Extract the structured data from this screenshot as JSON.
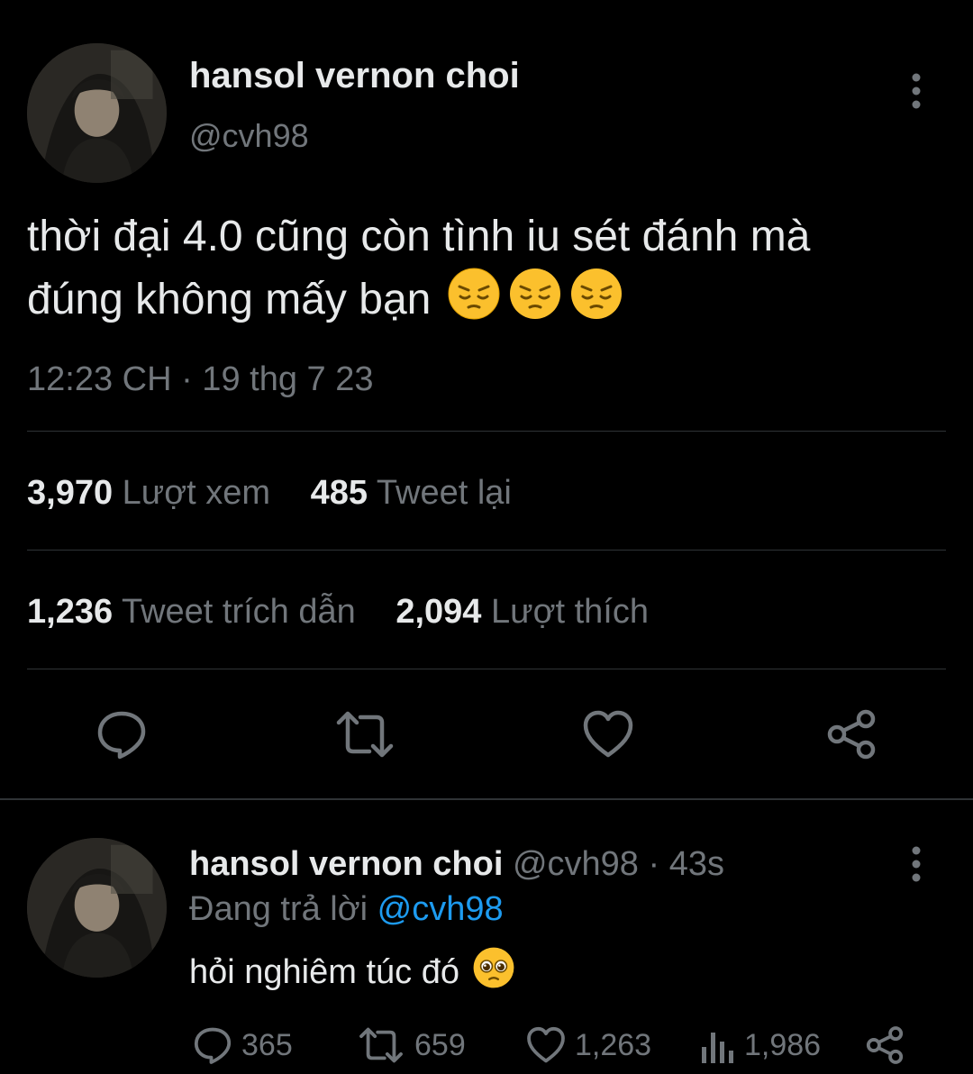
{
  "main_tweet": {
    "author_name": "hansol vernon choi",
    "handle": "@cvh98",
    "text_line1": "thời đại 4.0 cũng còn tình iu sét đánh mà",
    "text_line2": "đúng không mấy bạn",
    "emojis": [
      "pensive-face",
      "pensive-face",
      "pensive-face"
    ],
    "timestamp": "12:23 CH · 19 thg 7 23",
    "stats": {
      "views_count": "3,970",
      "views_label": "Lượt xem",
      "retweets_count": "485",
      "retweets_label": "Tweet lại",
      "quotes_count": "1,236",
      "quotes_label": "Tweet trích dẫn",
      "likes_count": "2,094",
      "likes_label": "Lượt thích"
    },
    "actions": [
      "reply-icon",
      "retweet-icon",
      "like-icon",
      "share-icon"
    ]
  },
  "reply_tweet": {
    "author_name": "hansol vernon choi",
    "handle_time": "@cvh98 · 43s",
    "replying_prefix": "Đang trả lời",
    "replying_to": "@cvh98",
    "text": "hỏi nghiêm túc đó",
    "emoji": "pleading-face",
    "actions": {
      "replies": "365",
      "retweets": "659",
      "likes": "1,263",
      "views": "1,986"
    }
  },
  "colors": {
    "background": "#000000",
    "text": "#e7e9ea",
    "muted": "#71767b",
    "divider": "#2f3336",
    "link": "#1d9bf0"
  }
}
